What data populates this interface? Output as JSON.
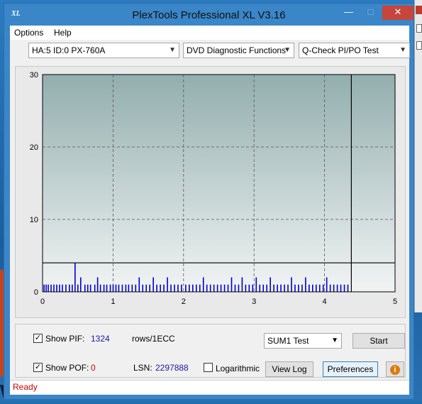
{
  "window": {
    "title": "PlexTools Professional XL V3.16",
    "app_icon": "XL"
  },
  "menu": {
    "options": "Options",
    "help": "Help"
  },
  "selectors": {
    "drive": "HA:5 ID:0  PX-760A",
    "function": "DVD Diagnostic Functions",
    "test": "Q-Check PI/PO Test"
  },
  "chart_data": {
    "type": "bar",
    "xlim": [
      0,
      5
    ],
    "ylim": [
      0,
      30
    ],
    "x_ticks": [
      "0",
      "1",
      "2",
      "3",
      "4",
      "5"
    ],
    "y_ticks": [
      "0",
      "10",
      "20",
      "30"
    ],
    "grid": true,
    "threshold_line": 4,
    "progress_marker_x": 4.38,
    "series": [
      {
        "color": "#0000cc",
        "x": [
          0.02,
          0.05,
          0.08,
          0.12,
          0.16,
          0.2,
          0.24,
          0.28,
          0.33,
          0.38,
          0.42,
          0.46,
          0.5,
          0.54,
          0.6,
          0.64,
          0.68,
          0.74,
          0.78,
          0.82,
          0.87,
          0.91,
          0.96,
          1.0,
          1.04,
          1.08,
          1.13,
          1.18,
          1.22,
          1.27,
          1.32,
          1.37,
          1.42,
          1.47,
          1.52,
          1.57,
          1.62,
          1.67,
          1.72,
          1.77,
          1.82,
          1.87,
          1.92,
          1.97,
          2.03,
          2.08,
          2.13,
          2.18,
          2.23,
          2.28,
          2.33,
          2.38,
          2.43,
          2.48,
          2.53,
          2.58,
          2.63,
          2.68,
          2.73,
          2.78,
          2.83,
          2.88,
          2.93,
          2.98,
          3.03,
          3.08,
          3.13,
          3.18,
          3.23,
          3.28,
          3.33,
          3.38,
          3.43,
          3.48,
          3.53,
          3.58,
          3.63,
          3.68,
          3.73,
          3.78,
          3.83,
          3.88,
          3.93,
          3.98,
          4.03,
          4.08,
          4.13,
          4.18,
          4.23,
          4.28,
          4.33
        ],
        "values": [
          1,
          1,
          1,
          1,
          1,
          1,
          1,
          1,
          1,
          1,
          1,
          4,
          1,
          2,
          1,
          1,
          1,
          1,
          2,
          1,
          1,
          1,
          1,
          1,
          1,
          1,
          1,
          1,
          1,
          1,
          1,
          2,
          1,
          1,
          1,
          2,
          1,
          1,
          1,
          2,
          1,
          1,
          1,
          1,
          1,
          1,
          1,
          1,
          1,
          2,
          1,
          1,
          1,
          1,
          1,
          1,
          1,
          2,
          1,
          1,
          2,
          1,
          1,
          1,
          2,
          1,
          1,
          1,
          2,
          1,
          1,
          1,
          1,
          1,
          2,
          1,
          1,
          1,
          2,
          1,
          1,
          1,
          1,
          1,
          2,
          1,
          1,
          1,
          1,
          1,
          1
        ]
      }
    ]
  },
  "controls": {
    "show_pif_label": "Show PIF:",
    "pif_value": "1324",
    "pif_unit": "rows/1ECC",
    "show_pof_label": "Show POF:",
    "pof_value": "0",
    "lsn_label": "LSN:",
    "lsn_value": "2297888",
    "logarithmic_label": "Logarithmic",
    "sum_test": "SUM1 Test",
    "start": "Start",
    "view_log": "View Log",
    "preferences": "Preferences",
    "show_pif_checked": "✓",
    "show_pof_checked": "✓"
  },
  "status": {
    "text": "Ready"
  },
  "desktop": {
    "fragment_text": "ws"
  }
}
